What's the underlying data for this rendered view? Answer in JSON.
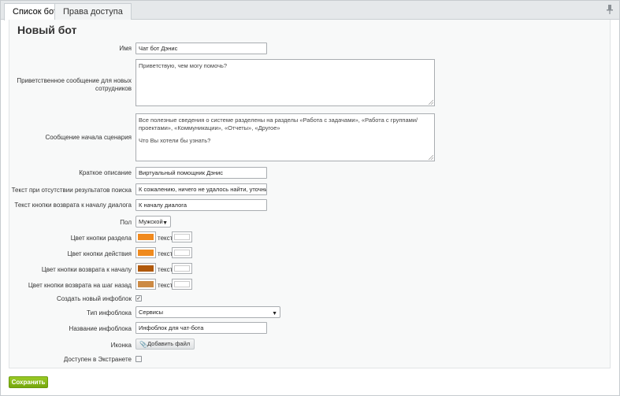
{
  "tabs": [
    "Список ботов",
    "Права доступа"
  ],
  "form_title": "Новый бот",
  "fields": {
    "name": {
      "label": "Имя",
      "value": "Чат бот Дэнис"
    },
    "greeting": {
      "label": "Приветственное сообщение для новых сотрудников",
      "value": "Приветствую, чем могу помочь?"
    },
    "scenario_start": {
      "label": "Сообщение начала сценария",
      "line1": "Все полезные сведения о системе разделены на разделы «Работа с задачами», «Работа с группами/проектами», «Коммуникации», «Отчеты», «Другое»",
      "line2": "Что Вы хотели бы узнать?"
    },
    "short_desc": {
      "label": "Краткое описание",
      "value": "Виртуальный помощник Дэнис"
    },
    "no_results": {
      "label": "Текст при отсутствии результатов поиска",
      "value": "К сожалению, ничего не удалось найти, уточните з"
    },
    "back_button_text": {
      "label": "Текст кнопки возврата к началу диалога",
      "value": "К началу диалога"
    },
    "gender": {
      "label": "Пол",
      "value": "Мужской"
    },
    "section_button_color": {
      "label": "Цвет кнопки раздела",
      "color": "#f0891d",
      "text_label": "текст",
      "text_color": "#ffffff"
    },
    "action_button_color": {
      "label": "Цвет кнопки действия",
      "color": "#ef8a1e",
      "text_label": "текст",
      "text_color": "#ffffff"
    },
    "back_start_color": {
      "label": "Цвет кнопки возврата к началу",
      "color": "#b0590c",
      "text_label": "текст",
      "text_color": "#ffffff"
    },
    "back_step_color": {
      "label": "Цвет кнопки возврата на шаг назад",
      "color": "#cc8a44",
      "text_label": "текст",
      "text_color": "#ffffff"
    },
    "create_iblock": {
      "label": "Создать новый инфоблок",
      "checked": true
    },
    "iblock_type": {
      "label": "Тип инфоблока",
      "value": "Сервисы"
    },
    "iblock_name": {
      "label": "Название инфоблока",
      "value": "Инфоблок для чат-бота"
    },
    "icon": {
      "label": "Иконка",
      "button": "Добавить файл"
    },
    "extranet": {
      "label": "Доступен в Экстранете",
      "checked": false
    }
  },
  "save_button": "Сохранить",
  "icons": {
    "pin": "pin-icon",
    "paperclip": "paperclip-icon",
    "caret": "chevron-down-icon"
  }
}
